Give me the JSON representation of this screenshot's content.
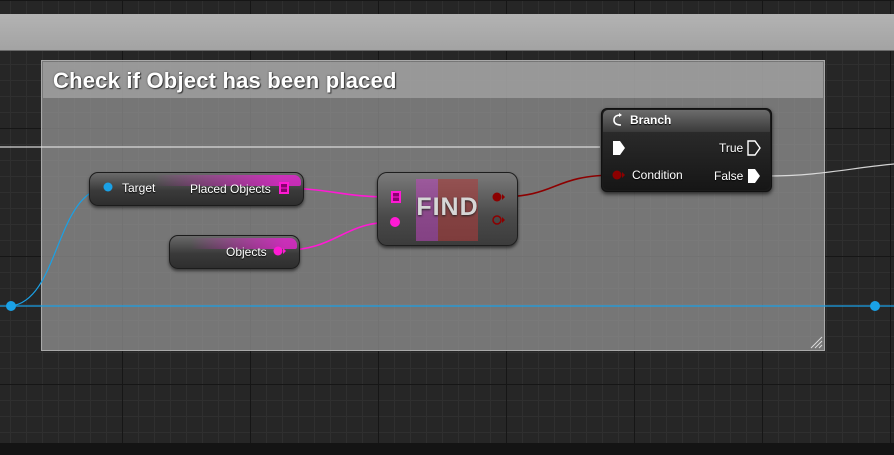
{
  "comment": {
    "title": "Check if Object has been placed"
  },
  "nodes": {
    "placed_objects_getter": {
      "target_pin_label": "Target",
      "output_pin_label": "Placed Objects"
    },
    "objects_getter": {
      "output_pin_label": "Objects"
    },
    "find_node": {
      "title": "FIND"
    },
    "branch_node": {
      "title": "Branch",
      "condition_pin_label": "Condition",
      "true_pin_label": "True",
      "false_pin_label": "False"
    }
  },
  "colors": {
    "object_reference_pin": "#1aa1e6",
    "array_pin": "#ff1ad4",
    "boolean_pin": "#8c0000",
    "exec_wire": "#ffffff",
    "grid_background": "#262626",
    "comment_fill": "#969696"
  },
  "icons": {
    "branch_icon": "branch-arrow",
    "array_pin_icon": "grid-array",
    "exec_pin_icon": "exec-arrow"
  }
}
